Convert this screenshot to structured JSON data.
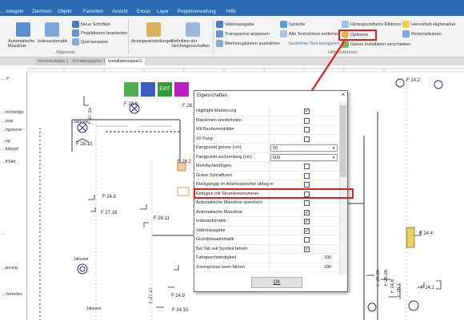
{
  "menubar": {
    "items": [
      "... ostegeln",
      "Zeichnen",
      "Objekt",
      "Favoriten",
      "Ansicht",
      "Extras",
      "Layer",
      "Projektverwaltung",
      "Hilfe"
    ]
  },
  "ribbon": {
    "automatic_dimension": "Automatische Masslinie",
    "index_automatic": "Indexautomatik",
    "new_font": "Neue Schriftart",
    "edit_projection": "Projektionen bearbeiten",
    "cross_reference": "Querverweise",
    "display_settings": "Anzeigeeinstellungen",
    "hatching_definition": "Definition der Strichelgenschaften",
    "vector_output": "Vektorausgabe",
    "adjust_transparency": "Transparenz anpassen",
    "tool_boxes": "Werkzeugkästen auswählen",
    "language": "Sprache",
    "remove_all_text_frames": "Alle Textrahmen entfernen",
    "rotated_text_correction": "Gedrehter Text korrigieren",
    "background_ribbons": "Hintergrundfarbe Ribbons",
    "options": "Optionen",
    "whole_installation": "Ganze Installation verschieben",
    "highlight_marker": "Hervorheb Highmarker",
    "personalize": "Personalisieren",
    "group_general": "Allgemein",
    "group_auxiliary": "Hilfsfunktionen"
  },
  "tabs": [
    "Stromlaufplan 1",
    "Schaltungsplan 1",
    "Installationsplan1"
  ],
  "left_panel": [
    "... P",
    "...rechange",
    "...iwar",
    "...ngstoner",
    "...ng",
    "...tulkopf",
    "...ifTakt",
    "...",
    "...ierung",
    "...Verteilen"
  ],
  "toolbar_text": "EXIT",
  "dialog": {
    "title": "Eigenschaften",
    "close": "×",
    "ok_label": "OK",
    "rows": [
      {
        "label": "Highlight Markierung",
        "type": "check",
        "checked": true
      },
      {
        "label": "Masslinien wiederholen",
        "type": "check",
        "checked": false
      },
      {
        "label": "Mit Bauherrenbilder",
        "type": "check",
        "checked": false
      },
      {
        "label": "X/I Fang",
        "type": "check",
        "checked": false
      },
      {
        "label": "Fangpunkt grösse (cm)",
        "type": "combo",
        "value": "50"
      },
      {
        "label": "Fangpunkt suchumfang (cm)",
        "type": "combo",
        "value": "500"
      },
      {
        "label": "Mehrfacheinfügen",
        "type": "check",
        "checked": false
      },
      {
        "label": "Graue Schraffuren",
        "type": "check",
        "checked": false
      },
      {
        "label": "Rückgängig im Arbeitsspeicher ablegen",
        "type": "check",
        "checked": false
      },
      {
        "label": "Einfügen mit Stromkreisnummer",
        "type": "check",
        "checked": false
      },
      {
        "label": "Automatische Masslinie speichern",
        "type": "check",
        "checked": false
      },
      {
        "label": "Automatische Masslinie",
        "type": "check",
        "checked": true
      },
      {
        "label": "Indexautomatik",
        "type": "check",
        "checked": true
      },
      {
        "label": "Vektorausgabe",
        "type": "check",
        "checked": true
      },
      {
        "label": "Grundrissautomatik",
        "type": "check",
        "checked": false
      },
      {
        "label": "Bei Tab auf Symbol fahren",
        "type": "check",
        "checked": true
      },
      {
        "label": "Fahrgeschwindigkeit",
        "type": "number",
        "value": "100"
      },
      {
        "label": "Zoomgrösse beim fahren",
        "type": "number",
        "value": "100"
      }
    ]
  },
  "drawing_labels": [
    "F 28.9",
    "F 28.10",
    "F 28.8",
    "F 27.15",
    "F 24.8",
    "F 27.16",
    "F 28.11",
    "F 28.2",
    "F 27.17",
    "F 24.9",
    "F 24.10",
    "F 14.2",
    "F 24.4",
    "F 28.25",
    "F 28.26",
    "F 24.1",
    "F 14.8",
    "F 28.1",
    "Jalousie",
    "Jalousie",
    "Jalousie",
    "F 22.1",
    "F 22.2"
  ],
  "colors": {
    "accent": "#2b6cb3",
    "highlight": "#e02020",
    "dialog_bg": "#ffffff"
  }
}
